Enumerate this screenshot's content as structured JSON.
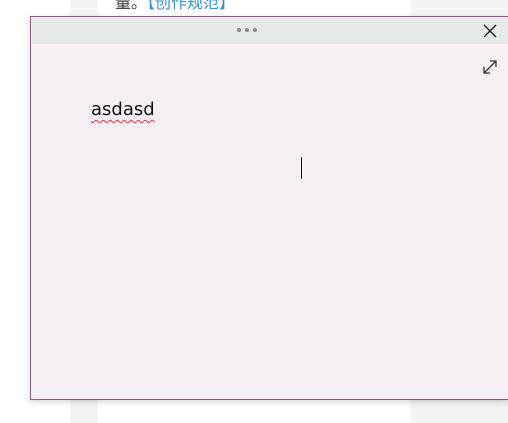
{
  "background": {
    "text_prefix": "量。",
    "link_label": "【创作规范】"
  },
  "note": {
    "content": "asdasd",
    "icons": {
      "drag": "drag-handle-icon",
      "close": "close-icon",
      "expand": "expand-icon"
    },
    "colors": {
      "background": "#f6eff6",
      "border": "#8b5a8b",
      "title_bar": "#e8e8e8"
    }
  }
}
